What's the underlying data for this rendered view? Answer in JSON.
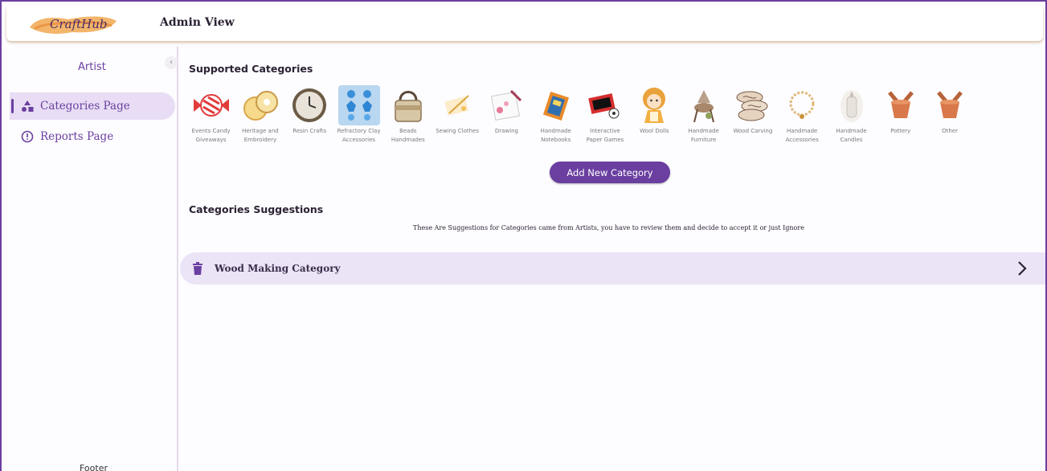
{
  "app": {
    "logo_text": "CraftHub",
    "title": "Admin View"
  },
  "sidebar": {
    "role": "Artist",
    "collapse_icon": "chevron-left-icon",
    "items": [
      {
        "label": "Categories Page",
        "icon": "shapes-icon",
        "active": true
      },
      {
        "label": "Reports Page",
        "icon": "alert-circle-icon",
        "active": false
      }
    ],
    "footer": "Footer"
  },
  "main": {
    "supported_title": "Supported Categories",
    "categories": [
      {
        "label": "Events Candy Giveaways",
        "icon": "candy-icon"
      },
      {
        "label": "Heritage and Embroidery",
        "icon": "embroidery-hoop-icon"
      },
      {
        "label": "Resin Crafts",
        "icon": "resin-clock-icon"
      },
      {
        "label": "Refractory Clay Accessories",
        "icon": "earrings-icon"
      },
      {
        "label": "Beads Handmades",
        "icon": "bead-bag-icon"
      },
      {
        "label": "Sewing Clothes",
        "icon": "sewing-icon"
      },
      {
        "label": "Drawing",
        "icon": "drawing-icon"
      },
      {
        "label": "Handmade Notebooks",
        "icon": "notebook-icon"
      },
      {
        "label": "Interactive Paper Games",
        "icon": "paper-game-icon"
      },
      {
        "label": "Wool Dolls",
        "icon": "wool-doll-icon"
      },
      {
        "label": "Handmade Furniture",
        "icon": "furniture-icon"
      },
      {
        "label": "Wood Carving",
        "icon": "wood-carving-icon"
      },
      {
        "label": "Handmade Accessories",
        "icon": "bracelet-icon"
      },
      {
        "label": "Handmade Candles",
        "icon": "candle-icon"
      },
      {
        "label": "Pottery",
        "icon": "pottery-icon"
      },
      {
        "label": "Other",
        "icon": "pottery-icon"
      }
    ],
    "add_button": "Add New Category",
    "suggestions_title": "Categories Suggestions",
    "suggestions_note": "These Are Suggestions for Categories came from Artists, you have to review them and decide to accept it or just Ignore",
    "suggestions": [
      {
        "label": "Wood Making Category",
        "icon": "trash-icon",
        "action_icon": "chevron-right-icon"
      }
    ]
  },
  "colors": {
    "accent": "#6a3fa0",
    "active_bg": "#e8ddf4",
    "suggestion_bg": "#ebe3f6",
    "border": "#6a3fa0"
  }
}
